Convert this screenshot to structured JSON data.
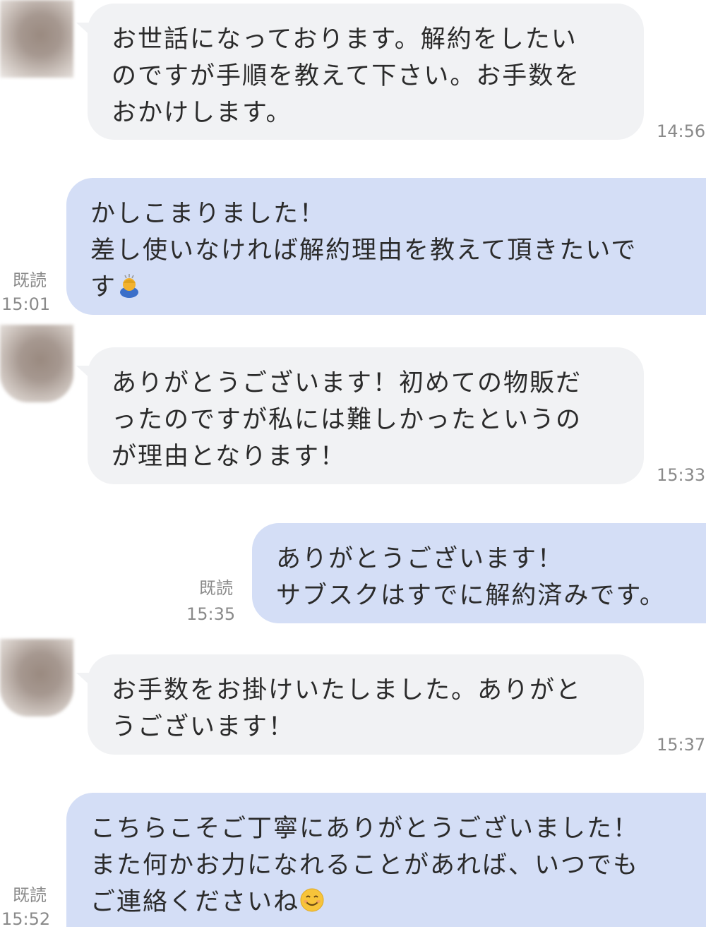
{
  "messages": [
    {
      "side": "incoming",
      "lines": [
        "お世話になっております。解約をしたい",
        "のですが手順を教えて下さい。お手数を",
        "おかけします。"
      ],
      "time": "14:56"
    },
    {
      "side": "outgoing",
      "lines": [
        "かしこまりました！",
        "差し使いなければ解約理由を教えて頂きたいで",
        "す"
      ],
      "emoji": "person-bowing-emoji",
      "read": "既読",
      "time": "15:01"
    },
    {
      "side": "incoming",
      "lines": [
        "ありがとうございます！初めての物販だ",
        "ったのですが私には難しかったというの",
        "が理由となります！"
      ],
      "time": "15:33"
    },
    {
      "side": "outgoing",
      "lines": [
        "ありがとうございます！",
        "サブスクはすでに解約済みです。"
      ],
      "read": "既読",
      "time": "15:35"
    },
    {
      "side": "incoming",
      "lines": [
        "お手数をお掛けいたしました。ありがと",
        "うございます！"
      ],
      "time": "15:37"
    },
    {
      "side": "outgoing",
      "lines": [
        "こちらこそご丁寧にありがとうございました！",
        "また何かお力になれることがあれば、いつでも",
        "ご連絡くださいね"
      ],
      "emoji": "smiling-face-emoji",
      "read": "既読",
      "time": "15:52"
    }
  ],
  "colors": {
    "incoming_bubble": "#f1f2f4",
    "outgoing_bubble": "#d4def6",
    "meta_text": "#8a8a8a",
    "message_text": "#2b2b2b"
  }
}
